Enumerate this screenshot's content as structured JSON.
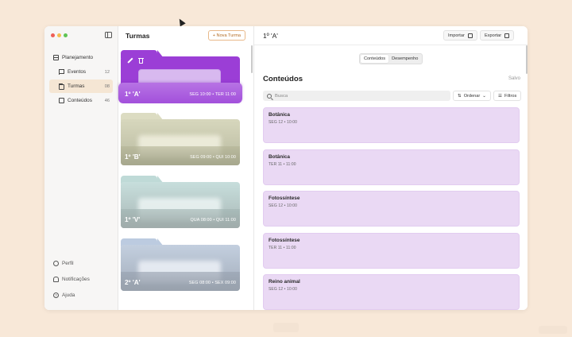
{
  "sidebar": {
    "items": [
      {
        "label": "Planejamento",
        "icon": "calendar-icon",
        "count": ""
      },
      {
        "label": "Eventos",
        "icon": "flag-icon",
        "count": "12"
      },
      {
        "label": "Turmas",
        "icon": "folder-icon",
        "count": "08"
      },
      {
        "label": "Conteúdos",
        "icon": "document-icon",
        "count": "46"
      }
    ],
    "bottom": [
      {
        "label": "Perfil",
        "icon": "profile-icon"
      },
      {
        "label": "Notificações",
        "icon": "bell-icon"
      },
      {
        "label": "Ajuda",
        "icon": "help-icon"
      }
    ]
  },
  "turmas": {
    "title": "Turmas",
    "new_label": "+ Nova Turma",
    "folders": [
      {
        "name": "1º 'A'",
        "schedule": "SEG 10:00 • TER 11:00"
      },
      {
        "name": "1º 'B'",
        "schedule": "SEG 09:00 • QUI 10:00"
      },
      {
        "name": "1º 'V'",
        "schedule": "QUA 08:00 • QUI 11:00"
      },
      {
        "name": "2º 'A'",
        "schedule": "SEG 08:00 • SEX 09:00"
      }
    ]
  },
  "detail": {
    "title": "1º 'A'",
    "import_label": "Importar",
    "export_label": "Exportar",
    "tabs": [
      "Conteúdos",
      "Desempenho"
    ],
    "heading": "Conteúdos",
    "saved": "Salvo",
    "search_placeholder": "Busca",
    "sort_label": "Ordenar",
    "filter_label": "Filtros",
    "cards": [
      {
        "title": "Botânica",
        "schedule": "SEG 12 • 10:00"
      },
      {
        "title": "Botânica",
        "schedule": "TER 11 • 11:00"
      },
      {
        "title": "Fotossíntese",
        "schedule": "SEG 12 • 10:00"
      },
      {
        "title": "Fotossíntese",
        "schedule": "TER 11 • 11:00"
      },
      {
        "title": "Reino animal",
        "schedule": "SEG 12 • 10:00"
      }
    ]
  },
  "colors": {
    "accent": "#9b3ed6",
    "card": "#ead9f4",
    "background": "#f8e8d8"
  }
}
